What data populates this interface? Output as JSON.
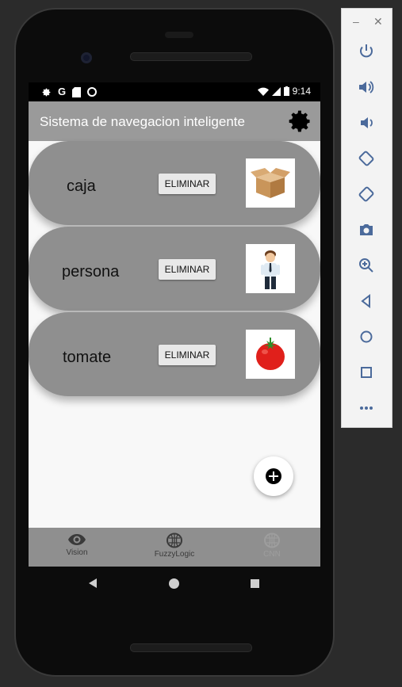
{
  "status_bar": {
    "left_icons": [
      "gear-icon",
      "google-icon",
      "sd-card-icon",
      "circle-icon"
    ],
    "time": "9:14"
  },
  "app_bar": {
    "title": "Sistema de navegacion inteligente",
    "settings_icon": "gear-icon"
  },
  "items": [
    {
      "label": "caja",
      "delete_label": "ELIMINAR",
      "image": "box-image"
    },
    {
      "label": "persona",
      "delete_label": "ELIMINAR",
      "image": "person-image"
    },
    {
      "label": "tomate",
      "delete_label": "ELIMINAR",
      "image": "tomato-image"
    }
  ],
  "fab": {
    "icon": "add-circle-icon"
  },
  "bottom_nav": [
    {
      "label": "Vision",
      "icon": "eye-icon",
      "enabled": true
    },
    {
      "label": "FuzzyLogic",
      "icon": "brain-icon",
      "enabled": true
    },
    {
      "label": "CNN",
      "icon": "brain-icon",
      "enabled": false
    }
  ],
  "colors": {
    "app_bar": "#9a9a9a",
    "card": "#8f8f8f",
    "screen_bg": "#f8f8f8",
    "bottom_nav": "#8f8f8f"
  },
  "emulator_controls": [
    "power-icon",
    "volume-up-icon",
    "volume-down-icon",
    "rotate-left-icon",
    "rotate-right-icon",
    "camera-icon",
    "zoom-icon",
    "back-icon",
    "home-icon",
    "overview-icon",
    "more-icon"
  ]
}
